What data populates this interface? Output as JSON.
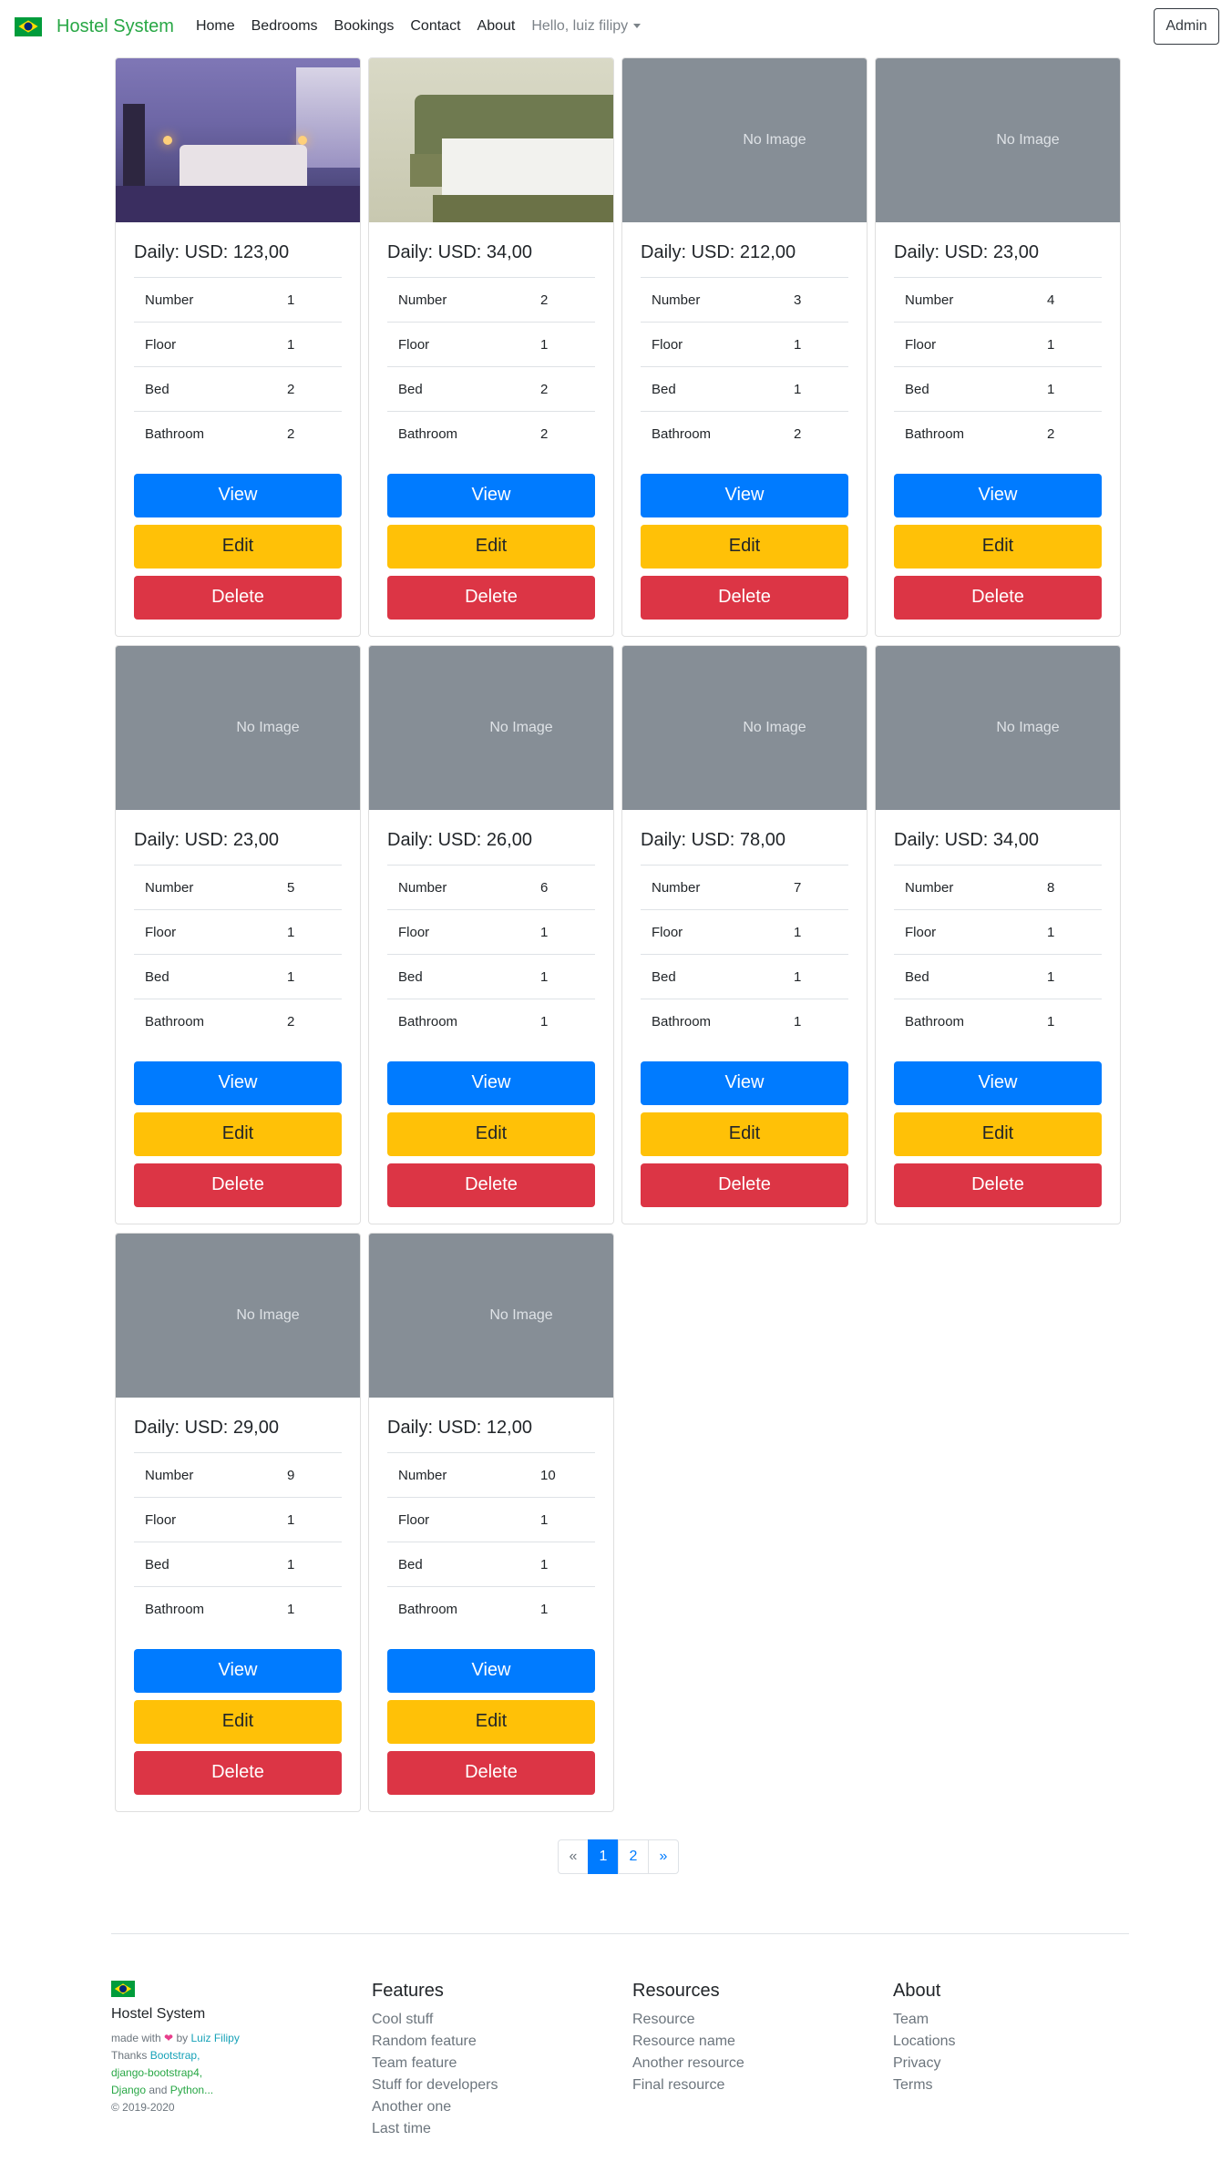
{
  "navbar": {
    "brand": "Hostel System",
    "links": [
      "Home",
      "Bedrooms",
      "Bookings",
      "Contact",
      "About"
    ],
    "user": "Hello, luiz filipy",
    "admin_button": "Admin"
  },
  "no_image_text": "No Image",
  "labels": {
    "price_prefix": "Daily: USD: ",
    "number": "Number",
    "floor": "Floor",
    "bed": "Bed",
    "bathroom": "Bathroom",
    "view": "View",
    "edit": "Edit",
    "delete": "Delete"
  },
  "rooms": [
    {
      "price": "Daily: USD: 123,00",
      "number": "1",
      "floor": "1",
      "bed": "2",
      "bathroom": "2",
      "image": "photo-bedroom-purple"
    },
    {
      "price": "Daily: USD: 34,00",
      "number": "2",
      "floor": "1",
      "bed": "2",
      "bathroom": "2",
      "image": "photo-bedroom-green"
    },
    {
      "price": "Daily: USD: 212,00",
      "number": "3",
      "floor": "1",
      "bed": "1",
      "bathroom": "2",
      "image": "none"
    },
    {
      "price": "Daily: USD: 23,00",
      "number": "4",
      "floor": "1",
      "bed": "1",
      "bathroom": "2",
      "image": "none"
    },
    {
      "price": "Daily: USD: 23,00",
      "number": "5",
      "floor": "1",
      "bed": "1",
      "bathroom": "2",
      "image": "none"
    },
    {
      "price": "Daily: USD: 26,00",
      "number": "6",
      "floor": "1",
      "bed": "1",
      "bathroom": "1",
      "image": "none"
    },
    {
      "price": "Daily: USD: 78,00",
      "number": "7",
      "floor": "1",
      "bed": "1",
      "bathroom": "1",
      "image": "none"
    },
    {
      "price": "Daily: USD: 34,00",
      "number": "8",
      "floor": "1",
      "bed": "1",
      "bathroom": "1",
      "image": "none"
    },
    {
      "price": "Daily: USD: 29,00",
      "number": "9",
      "floor": "1",
      "bed": "1",
      "bathroom": "1",
      "image": "none"
    },
    {
      "price": "Daily: USD: 12,00",
      "number": "10",
      "floor": "1",
      "bed": "1",
      "bathroom": "1",
      "image": "none"
    }
  ],
  "pagination": {
    "prev": "«",
    "pages": [
      "1",
      "2"
    ],
    "active": "1",
    "next": "»"
  },
  "footer": {
    "brand": "Hostel System",
    "made_with": "made with",
    "by": "by",
    "author": "Luiz Filipy",
    "thanks": "Thanks",
    "bootstrap": "Bootstrap,",
    "django_bootstrap4": "django-bootstrap4,",
    "django": "Django",
    "and": "and",
    "python": "Python...",
    "copyright": "© 2019-2020",
    "columns": [
      {
        "title": "Features",
        "links": [
          "Cool stuff",
          "Random feature",
          "Team feature",
          "Stuff for developers",
          "Another one",
          "Last time"
        ]
      },
      {
        "title": "Resources",
        "links": [
          "Resource",
          "Resource name",
          "Another resource",
          "Final resource"
        ]
      },
      {
        "title": "About",
        "links": [
          "Team",
          "Locations",
          "Privacy",
          "Terms"
        ]
      }
    ]
  },
  "colors": {
    "brand_green": "#28a745",
    "primary": "#007bff",
    "warning": "#ffc107",
    "danger": "#dc3545",
    "placeholder": "#868e96"
  }
}
